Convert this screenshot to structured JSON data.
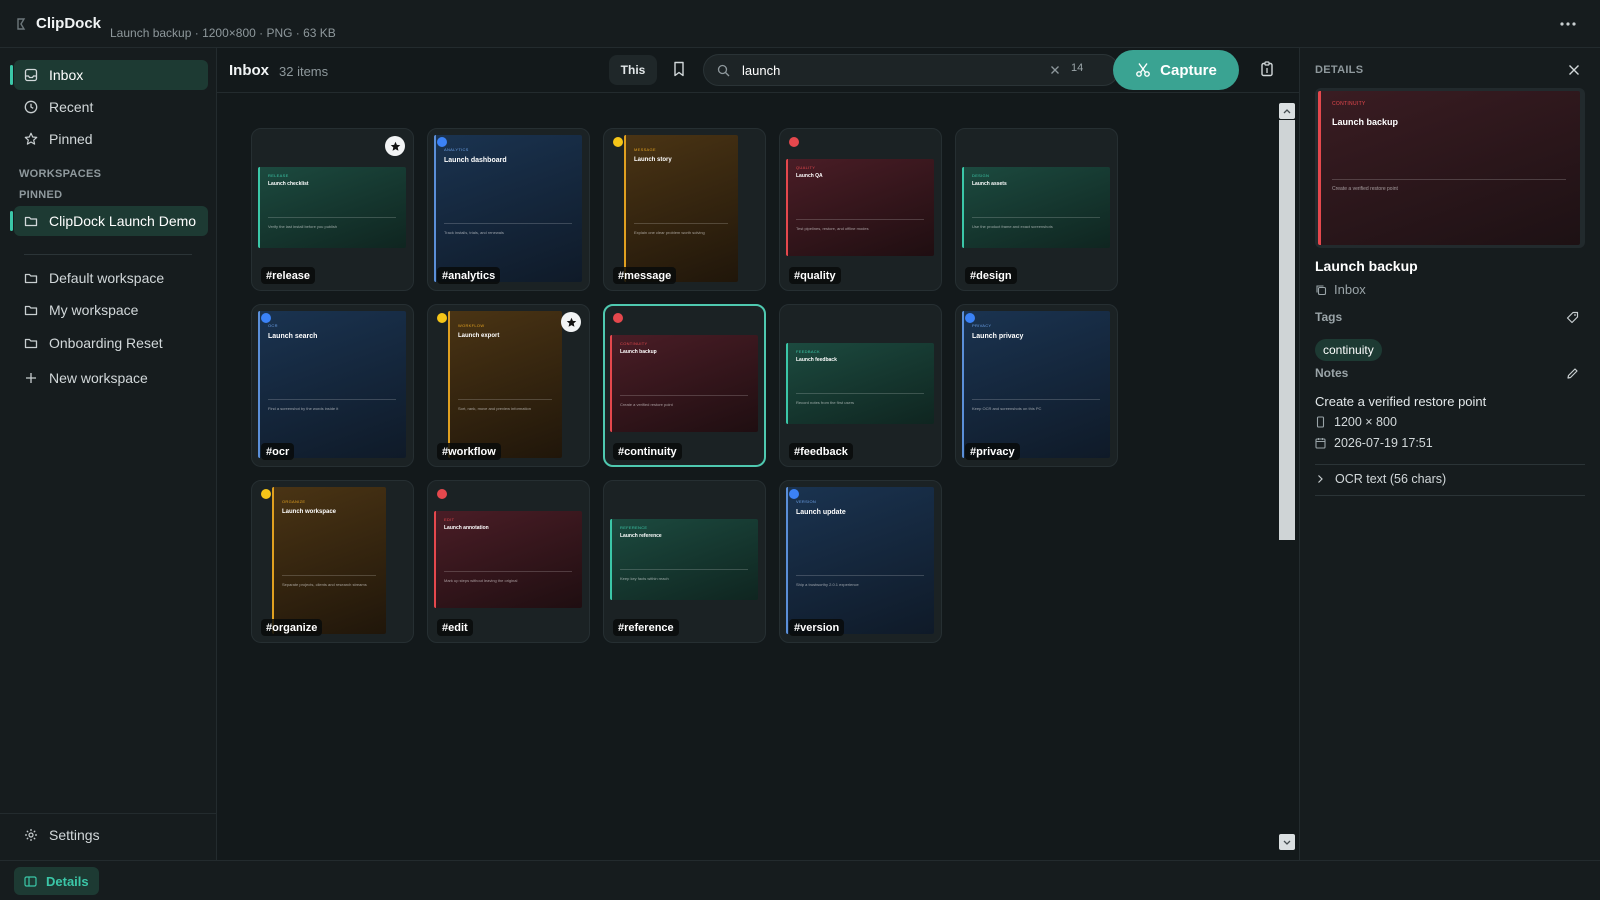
{
  "app": {
    "name": "ClipDock",
    "file_meta": "Launch backup · 1200×800 · PNG · 63 KB"
  },
  "sidebar": {
    "nav": [
      {
        "label": "Inbox",
        "icon": "inbox-icon",
        "active": true
      },
      {
        "label": "Recent",
        "icon": "clock-icon"
      },
      {
        "label": "Pinned",
        "icon": "star-icon"
      }
    ],
    "workspaces_label": "WORKSPACES",
    "pinned_label": "PINNED",
    "pinned_workspace": "ClipDock Launch Demo",
    "workspaces": [
      {
        "label": "Default workspace"
      },
      {
        "label": "My workspace"
      },
      {
        "label": "Onboarding Reset"
      }
    ],
    "new_workspace": "New workspace",
    "settings": "Settings"
  },
  "toolbar": {
    "title": "Inbox",
    "count": "32 items",
    "scope": "This",
    "search_value": "launch",
    "result_count": "14",
    "capture": "Capture"
  },
  "colors": {
    "accent": "#3bc7a8",
    "capture": "#3aa392",
    "blue": "#3b82f6",
    "yellow": "#f5c518",
    "red": "#e5484d"
  },
  "cards": [
    {
      "title": "Launch checklist",
      "kicker": "RELEASE",
      "desc": "Verify the last install before you publish",
      "tag": "#release",
      "theme": "green",
      "pinned": true
    },
    {
      "title": "Launch dashboard",
      "kicker": "ANALYTICS",
      "desc": "Track installs, trials, and renewals",
      "tag": "#analytics",
      "theme": "blue",
      "dot": "blue"
    },
    {
      "title": "Launch story",
      "kicker": "MESSAGE",
      "desc": "Explain one clear problem worth solving",
      "tag": "#message",
      "theme": "amber",
      "dot": "yellow"
    },
    {
      "title": "Launch QA",
      "kicker": "QUALITY",
      "desc": "Test pipelines, restore, and offline modes",
      "tag": "#quality",
      "theme": "red",
      "dot": "red"
    },
    {
      "title": "Launch assets",
      "kicker": "DESIGN",
      "desc": "Use the product frame and exact screenshots",
      "tag": "#design",
      "theme": "green"
    },
    {
      "title": "Launch search",
      "kicker": "OCR",
      "desc": "Find a screenshot by the words inside it",
      "tag": "#ocr",
      "theme": "blue",
      "dot": "blue"
    },
    {
      "title": "Launch export",
      "kicker": "WORKFLOW",
      "desc": "Sort, rank, move and preview information",
      "tag": "#workflow",
      "theme": "amber",
      "dot": "yellow",
      "pinned": true
    },
    {
      "title": "Launch backup",
      "kicker": "CONTINUITY",
      "desc": "Create a verified restore point",
      "tag": "#continuity",
      "theme": "red",
      "dot": "red",
      "selected": true
    },
    {
      "title": "Launch feedback",
      "kicker": "FEEDBACK",
      "desc": "Record notes from the first users",
      "tag": "#feedback",
      "theme": "green"
    },
    {
      "title": "Launch privacy",
      "kicker": "PRIVACY",
      "desc": "Keep OCR and screenshots on this PC",
      "tag": "#privacy",
      "theme": "blue",
      "dot": "blue"
    },
    {
      "title": "Launch workspace",
      "kicker": "ORGANIZE",
      "desc": "Separate projects, clients and research streams",
      "tag": "#organize",
      "theme": "amber",
      "dot": "yellow"
    },
    {
      "title": "Launch annotation",
      "kicker": "EDIT",
      "desc": "Mark up steps without leaving the original",
      "tag": "#edit",
      "theme": "red",
      "dot": "red"
    },
    {
      "title": "Launch reference",
      "kicker": "REFERENCE",
      "desc": "Keep key facts within reach",
      "tag": "#reference",
      "theme": "green"
    },
    {
      "title": "Launch update",
      "kicker": "VERSION",
      "desc": "Ship a trustworthy 2.0.1 experience",
      "tag": "#version",
      "theme": "blue",
      "dot": "blue"
    }
  ],
  "details": {
    "heading": "DETAILS",
    "preview_kicker": "CONTINUITY",
    "preview_title": "Launch backup",
    "preview_desc": "Create a verified restore point",
    "title": "Launch backup",
    "location": "Inbox",
    "tags_label": "Tags",
    "tags": [
      "continuity"
    ],
    "notes_label": "Notes",
    "notes": "Create a verified restore point",
    "dimensions": "1200 × 800",
    "date": "2026-07-19 17:51",
    "ocr": "OCR text (56 chars)"
  },
  "bottombar": {
    "details_label": "Details"
  }
}
